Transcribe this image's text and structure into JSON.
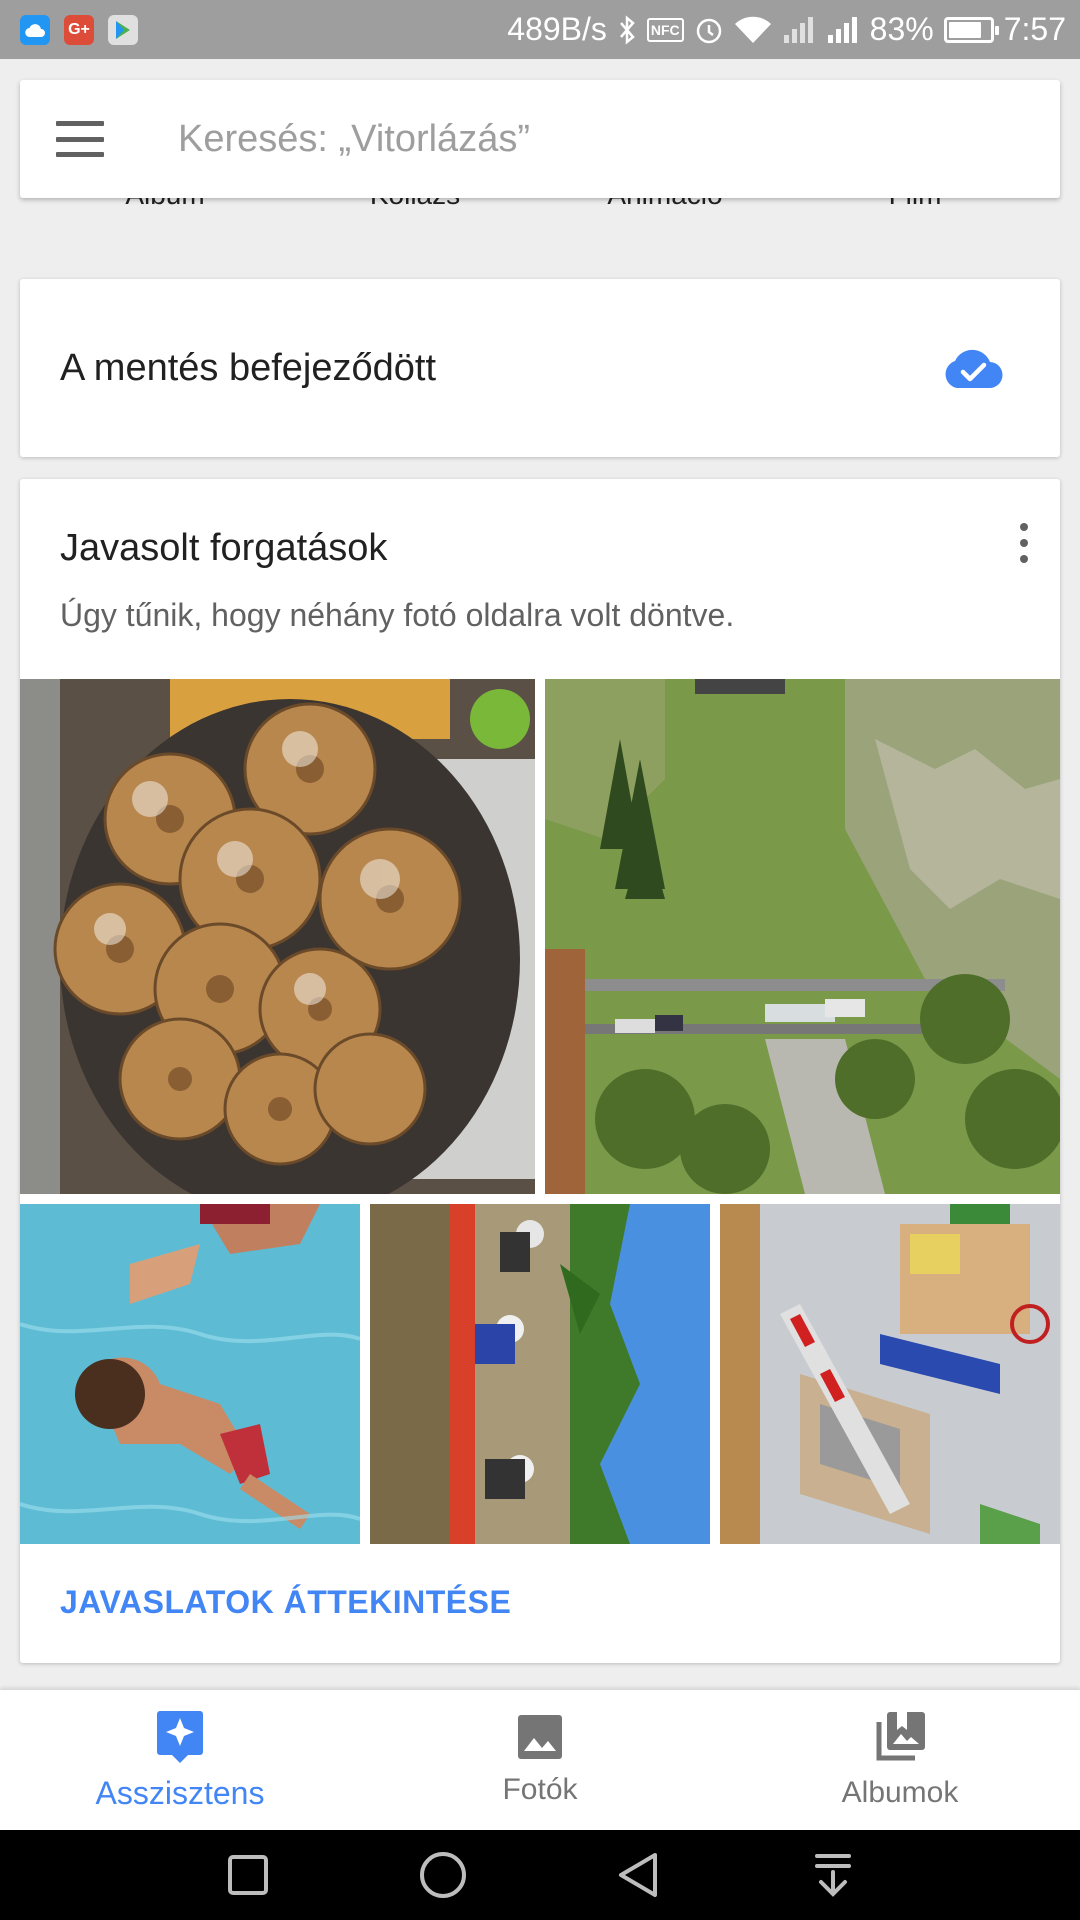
{
  "status_bar": {
    "network_speed": "489B/s",
    "nfc_label": "NFC",
    "battery_percent": "83%",
    "battery_level": 0.83,
    "time": "7:57",
    "notification_icons": [
      "cloud-icon",
      "google-plus-icon",
      "play-store-icon"
    ]
  },
  "search": {
    "placeholder": "Keresés: „Vitorlázás”"
  },
  "create_row": {
    "items": [
      "Album",
      "Kollázs",
      "Animáció",
      "Film"
    ]
  },
  "backup_card": {
    "text": "A mentés befejeződött",
    "status_icon": "cloud-done-icon",
    "accent": "#4285f4"
  },
  "suggestions_card": {
    "title": "Javasolt forgatások",
    "subtitle": "Úgy tűnik, hogy néhány fotó oldalra volt döntve.",
    "photos": [
      "donuts-photo",
      "mountain-railway-photo",
      "swimming-pool-photo",
      "kayaking-photo",
      "lego-station-photo"
    ],
    "action": "JAVASLATOK ÁTTEKINTÉSE"
  },
  "bottom_nav": {
    "items": [
      {
        "label": "Asszisztens",
        "icon": "assistant-icon",
        "active": true
      },
      {
        "label": "Fotók",
        "icon": "photo-icon",
        "active": false
      },
      {
        "label": "Albumok",
        "icon": "albums-icon",
        "active": false
      }
    ]
  },
  "system_nav": [
    "recents-icon",
    "home-icon",
    "back-icon",
    "notification-pull-icon"
  ],
  "colors": {
    "accent": "#4285f4",
    "status_bar": "#9e9e9e",
    "background": "#eeeeee"
  }
}
